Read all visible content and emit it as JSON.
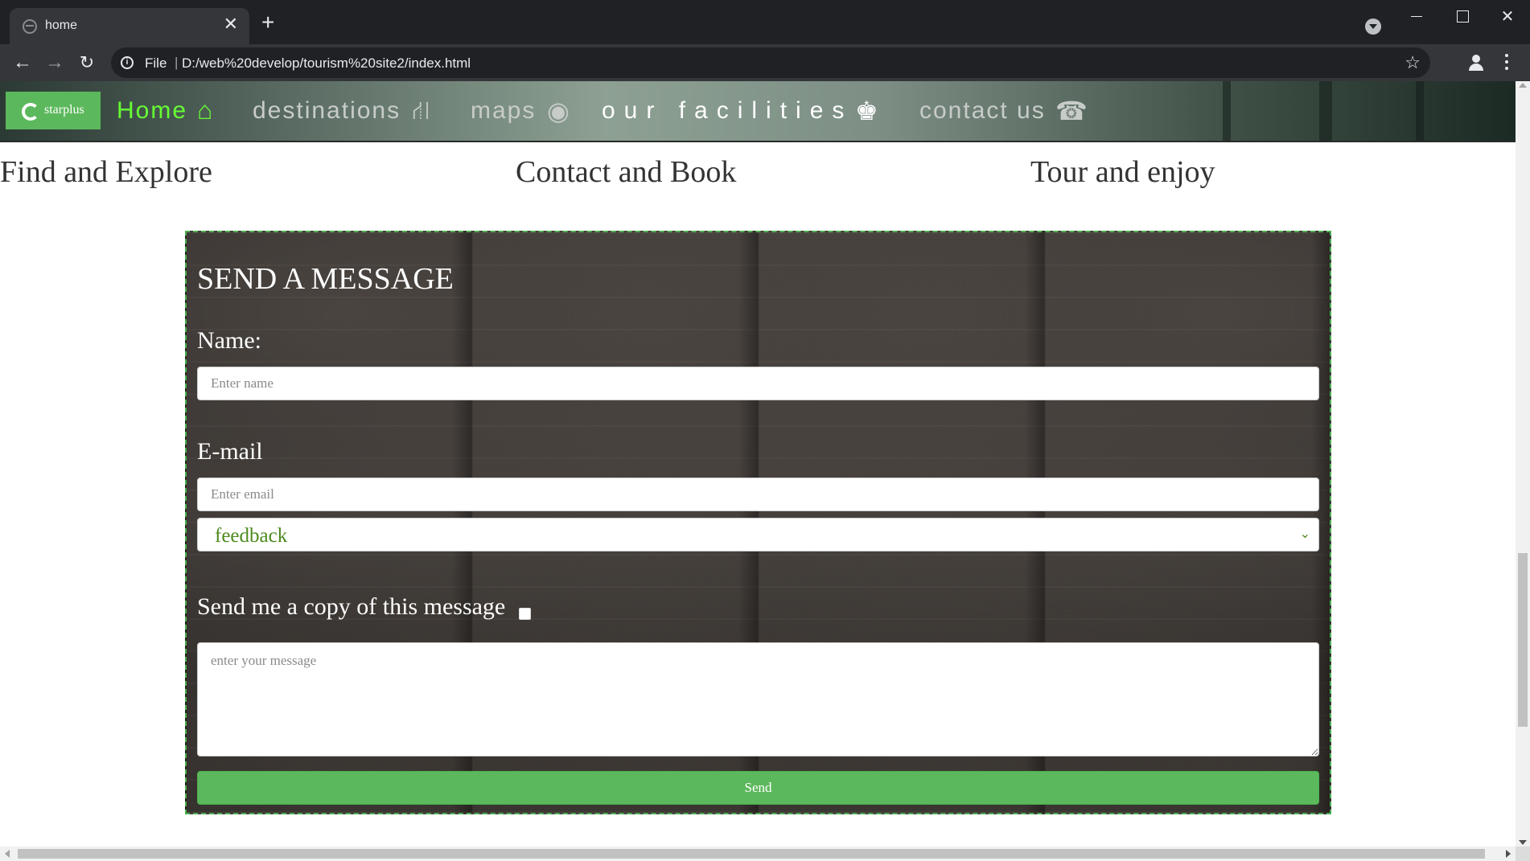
{
  "browser": {
    "tab_title": "home",
    "tab_close": "✕",
    "new_tab": "+",
    "scheme_label": "File",
    "separator": "|",
    "url": "D:/web%20develop/tourism%20site2/index.html",
    "icons": [
      "globe-icon",
      "close-icon",
      "plus-icon",
      "tab-search-icon",
      "back-icon",
      "forward-icon",
      "reload-icon",
      "info-icon",
      "star-icon",
      "profile-icon",
      "menu-icon"
    ]
  },
  "site_nav": {
    "logo_text": "starplus",
    "links": [
      {
        "label": "Home",
        "icon": "home-icon",
        "active": true
      },
      {
        "label": "destinations",
        "icon": "road-icon"
      },
      {
        "label": "maps",
        "icon": "eye-icon"
      },
      {
        "label": "our facilities",
        "icon": "king-icon"
      },
      {
        "label": "contact us",
        "icon": "phone-icon"
      }
    ],
    "colors": {
      "active": "#66ff33",
      "logo_bg": "#5cb85c"
    }
  },
  "headlines": [
    "Find and Explore",
    "Contact and Book",
    "Tour and enjoy"
  ],
  "message_form": {
    "title": "SEND A MESSAGE",
    "name_label": "Name:",
    "name_placeholder": "Enter name",
    "email_label": "E-mail",
    "email_placeholder": "Enter email",
    "subject_selected": "feedback",
    "copy_label": "Send me a copy of this message",
    "copy_checked": false,
    "message_placeholder": "enter your message",
    "send_label": "Send",
    "colors": {
      "border": "#4caf50",
      "button": "#5cb85c",
      "select_text": "#4c8a1e"
    }
  }
}
